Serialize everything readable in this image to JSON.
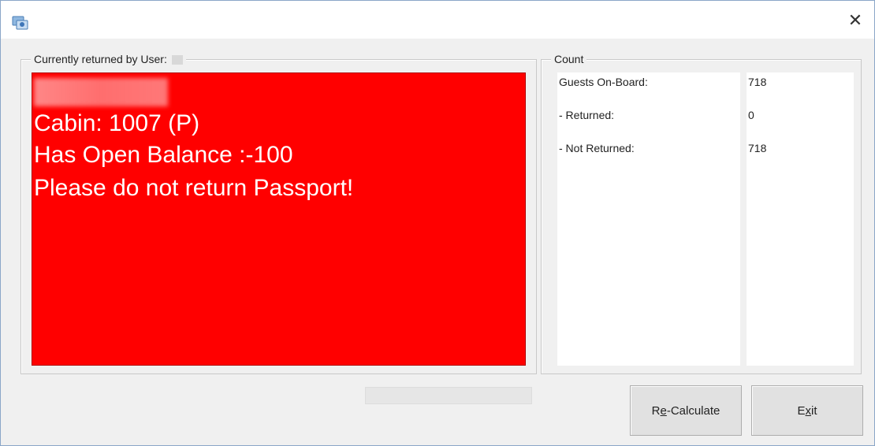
{
  "window": {
    "title": "",
    "close_glyph": "✕"
  },
  "icons": {
    "app": "app-icon",
    "close": "close-icon"
  },
  "left_panel": {
    "legend": "Currently returned by User:",
    "alert": {
      "background_color": "#ff0000",
      "text_color": "#ffffff",
      "lines": [
        "Cabin: 1007 (P)",
        "Has Open Balance :-100",
        "Please do not return Passport!"
      ]
    }
  },
  "count_panel": {
    "legend": "Count",
    "rows": [
      {
        "label": "Guests On-Board:",
        "value": "718"
      },
      {
        "label": "- Returned:",
        "value": "0"
      },
      {
        "label": "- Not Returned:",
        "value": "718"
      }
    ]
  },
  "buttons": {
    "recalculate": {
      "before": "R",
      "mnemonic": "e",
      "after": "-Calculate"
    },
    "exit": {
      "before": "E",
      "mnemonic": "x",
      "after": "it"
    }
  }
}
